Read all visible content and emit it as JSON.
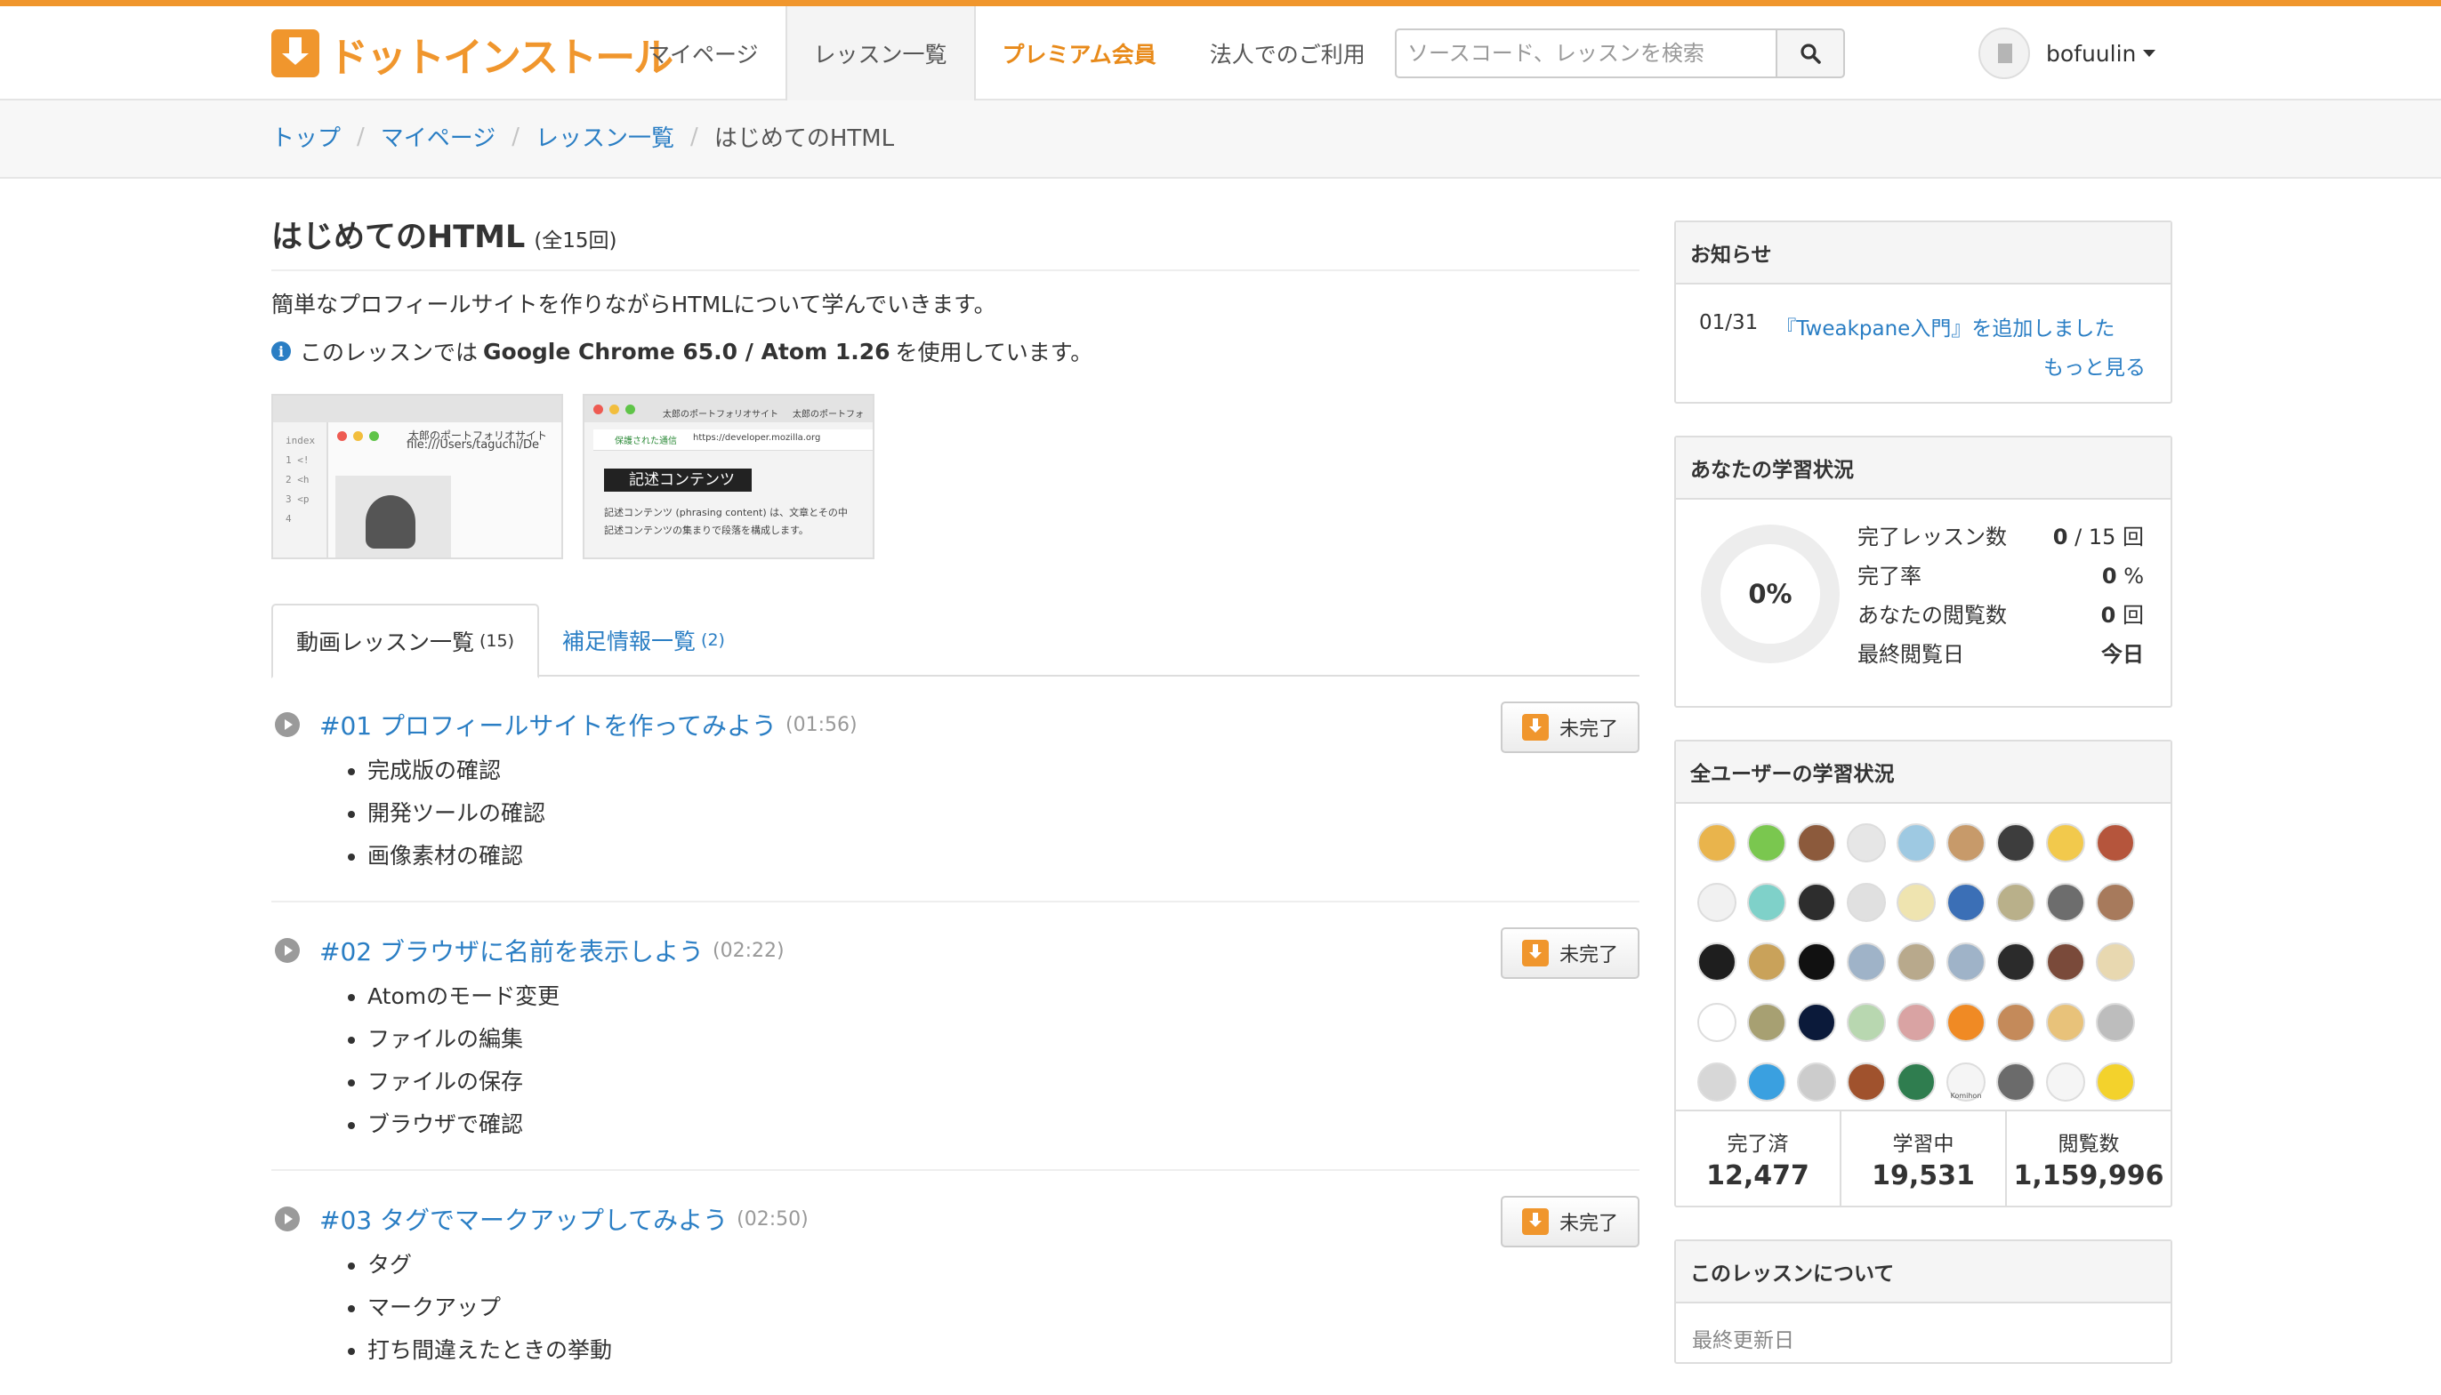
{
  "header": {
    "logo_text": "ドットインストール",
    "nav": [
      {
        "label": "マイページ"
      },
      {
        "label": "レッスン一覧"
      },
      {
        "label": "プレミアム会員"
      },
      {
        "label": "法人でのご利用"
      }
    ],
    "search_placeholder": "ソースコード、レッスンを検索",
    "username": "bofuulin"
  },
  "breadcrumb": [
    "トップ",
    "マイページ",
    "レッスン一覧",
    "はじめてのHTML"
  ],
  "lesson_page": {
    "title": "はじめてのHTML",
    "count": "(全15回)",
    "description": "簡単なプロフィールサイトを作りながらHTMLについて学んでいきます。",
    "info_prefix": "このレッスンでは",
    "info_tools": "Google Chrome 65.0 / Atom 1.26",
    "info_suffix": "を使用しています。",
    "thumb1": {
      "tab": "index",
      "site_tab": "太郎のポートフォリオサイト",
      "url": "file:///Users/taguchi/De",
      "code": [
        "1 <!",
        "2 <h",
        "3 <p",
        "4"
      ]
    },
    "thumb2": {
      "tab_a": "太郎のポートフォリオサイト",
      "tab_b": "太郎のポートフォ",
      "secure": "保護された通信",
      "url": "https://developer.mozilla.org",
      "heading": "記述コンテンツ",
      "text1": "記述コンテンツ (phrasing content) は、文章とその中",
      "text2": "記述コンテンツの集まりで段落を構成します。"
    }
  },
  "tabs": [
    {
      "label": "動画レッスン一覧",
      "count": "(15)"
    },
    {
      "label": "補足情報一覧",
      "count": "(2)"
    }
  ],
  "lessons": [
    {
      "title": "#01 プロフィールサイトを作ってみよう",
      "duration": "(01:56)",
      "items": [
        "完成版の確認",
        "開発ツールの確認",
        "画像素材の確認"
      ],
      "button": "未完了"
    },
    {
      "title": "#02 ブラウザに名前を表示しよう",
      "duration": "(02:22)",
      "items": [
        "Atomのモード変更",
        "ファイルの編集",
        "ファイルの保存",
        "ブラウザで確認"
      ],
      "button": "未完了"
    },
    {
      "title": "#03 タグでマークアップしてみよう",
      "duration": "(02:50)",
      "items": [
        "タグ",
        "マークアップ",
        "打ち間違えたときの挙動"
      ],
      "button": "未完了"
    }
  ],
  "sidebar": {
    "news": {
      "heading": "お知らせ",
      "date": "01/31",
      "text": "『Tweakpane入門』を追加しました",
      "more": "もっと見る"
    },
    "my_status": {
      "heading": "あなたの学習状況",
      "percent": "0%",
      "stats": [
        {
          "label": "完了レッスン数",
          "value": "0",
          "suffix": " / 15 回"
        },
        {
          "label": "完了率",
          "value": "0",
          "suffix": " %"
        },
        {
          "label": "あなたの閲覧数",
          "value": "0",
          "suffix": " 回"
        },
        {
          "label": "最終閲覧日",
          "value": "今日",
          "suffix": ""
        }
      ]
    },
    "all_status": {
      "heading": "全ユーザーの学習状況",
      "totals": [
        {
          "label": "完了済",
          "value": "12,477"
        },
        {
          "label": "学習中",
          "value": "19,531"
        },
        {
          "label": "閲覧数",
          "value": "1,159,996"
        }
      ],
      "avatar_colors": [
        "#e9b44c",
        "#7ac74f",
        "#8c5a3c",
        "#e6e6e6",
        "#9ec9e2",
        "#c79a6a",
        "#3d3d3d",
        "#f2c94c",
        "#b5553c",
        "#f1f1f1",
        "#7fd1c9",
        "#2d2d2d",
        "#e0e0e0",
        "#efe4b0",
        "#3b6fb6",
        "#b9b08a",
        "#6d6d6d",
        "#a77a5c",
        "#1e1e1e",
        "#c9a25a",
        "#111111",
        "#9fb3c8",
        "#b8a98c",
        "#9fb3c8",
        "#2b2b2b",
        "#7a4a3a",
        "#e8d8b0",
        "#ffffff",
        "#a7a072",
        "#0b1a3a",
        "#b8d7b0",
        "#d9a3a3",
        "#f08a24",
        "#c48a5a",
        "#e8c27a",
        "#bdbdbd",
        "#d7d7d7",
        "#3aa0e0",
        "#cccccc",
        "#a0522d",
        "#2f7d4f",
        "#f5f5f5",
        "#6b6b6b",
        "#f5f5f5",
        "#f3d22c"
      ],
      "avatar_label": "Komihon"
    },
    "about": {
      "heading": "このレッスンについて",
      "updated_label": "最終更新日"
    }
  },
  "colors": {
    "brand": "#f0962d",
    "link": "#2a7ec4"
  }
}
